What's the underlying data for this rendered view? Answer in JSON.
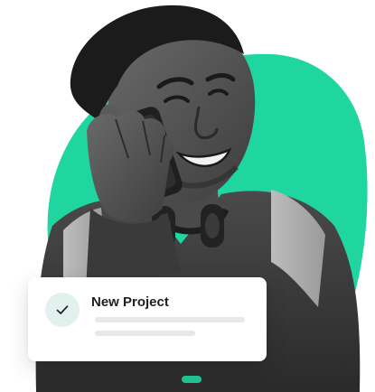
{
  "colors": {
    "accent": "#1fd6a0",
    "card_bg": "#ffffff",
    "badge_bg": "#e3f1ee",
    "check": "#1f1f1f",
    "placeholder_line": "#e6e8ea"
  },
  "hero": {
    "photo_subject": "person-on-phone-photo"
  },
  "card": {
    "title": "New Project",
    "icon": "check-icon"
  }
}
